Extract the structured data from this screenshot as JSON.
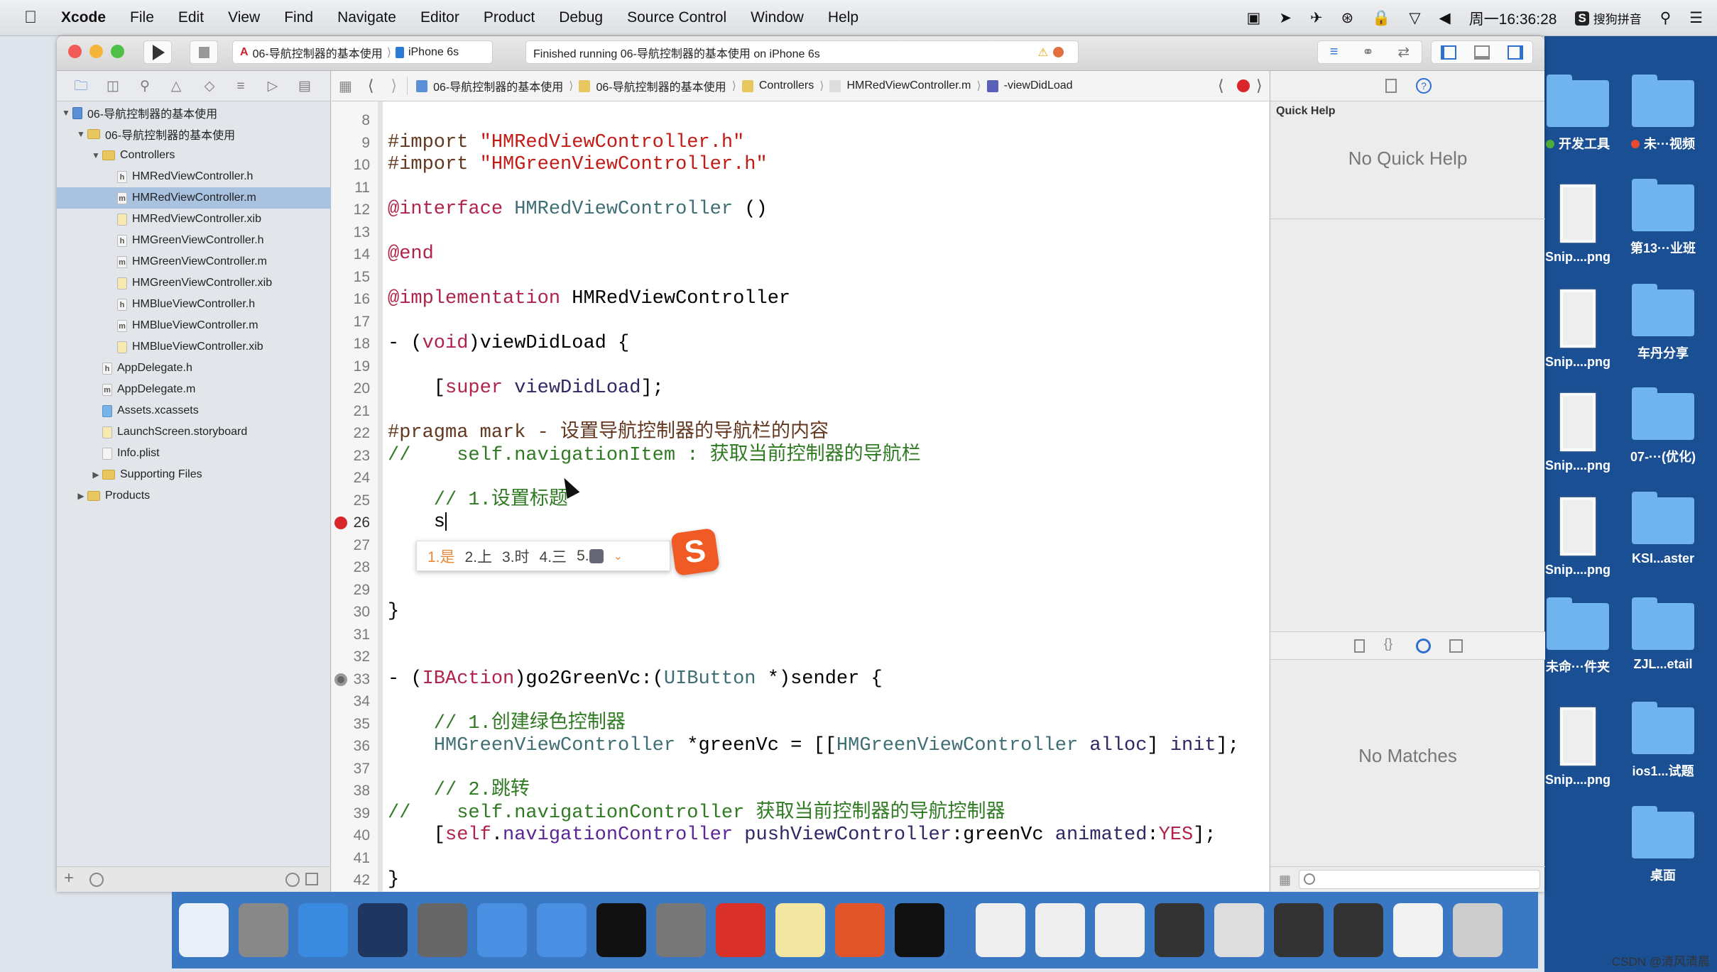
{
  "menubar": {
    "app": "Xcode",
    "items": [
      "File",
      "Edit",
      "View",
      "Find",
      "Navigate",
      "Editor",
      "Product",
      "Debug",
      "Source Control",
      "Window",
      "Help"
    ],
    "clock": "周一16:36:28",
    "ime": "搜狗拼音"
  },
  "toolbar": {
    "scheme": "06-导航控制器的基本使用",
    "device": "iPhone 6s",
    "status": "Finished running 06-导航控制器的基本使用 on iPhone 6s"
  },
  "jumpbar": [
    "06-导航控制器的基本使用",
    "06-导航控制器的基本使用",
    "Controllers",
    "HMRedViewController.m",
    "-viewDidLoad"
  ],
  "navigator": {
    "items": [
      {
        "label": "06-导航控制器的基本使用",
        "level": 0,
        "kind": "proj",
        "open": true
      },
      {
        "label": "06-导航控制器的基本使用",
        "level": 1,
        "kind": "folder",
        "open": true
      },
      {
        "label": "Controllers",
        "level": 2,
        "kind": "folder",
        "open": true
      },
      {
        "label": "HMRedViewController.h",
        "level": 3,
        "kind": "h"
      },
      {
        "label": "HMRedViewController.m",
        "level": 3,
        "kind": "m",
        "selected": true
      },
      {
        "label": "HMRedViewController.xib",
        "level": 3,
        "kind": "xib"
      },
      {
        "label": "HMGreenViewController.h",
        "level": 3,
        "kind": "h"
      },
      {
        "label": "HMGreenViewController.m",
        "level": 3,
        "kind": "m"
      },
      {
        "label": "HMGreenViewController.xib",
        "level": 3,
        "kind": "xib"
      },
      {
        "label": "HMBlueViewController.h",
        "level": 3,
        "kind": "h"
      },
      {
        "label": "HMBlueViewController.m",
        "level": 3,
        "kind": "m"
      },
      {
        "label": "HMBlueViewController.xib",
        "level": 3,
        "kind": "xib"
      },
      {
        "label": "AppDelegate.h",
        "level": 2,
        "kind": "h"
      },
      {
        "label": "AppDelegate.m",
        "level": 2,
        "kind": "m"
      },
      {
        "label": "Assets.xcassets",
        "level": 2,
        "kind": "assets"
      },
      {
        "label": "LaunchScreen.storyboard",
        "level": 2,
        "kind": "xib"
      },
      {
        "label": "Info.plist",
        "level": 2,
        "kind": "plist"
      },
      {
        "label": "Supporting Files",
        "level": 2,
        "kind": "folder",
        "open": false
      },
      {
        "label": "Products",
        "level": 1,
        "kind": "folder",
        "open": false
      }
    ]
  },
  "code": [
    {
      "n": "8",
      "t": []
    },
    {
      "n": "9",
      "t": [
        [
          "pre",
          "#import "
        ],
        [
          "str",
          "\"HMRedViewController.h\""
        ]
      ]
    },
    {
      "n": "10",
      "t": [
        [
          "pre",
          "#import "
        ],
        [
          "str",
          "\"HMGreenViewController.h\""
        ]
      ]
    },
    {
      "n": "11",
      "t": []
    },
    {
      "n": "12",
      "t": [
        [
          "kw",
          "@interface "
        ],
        [
          "cls",
          "HMRedViewController"
        ],
        [
          "pl",
          " ()"
        ]
      ]
    },
    {
      "n": "13",
      "t": []
    },
    {
      "n": "14",
      "t": [
        [
          "kw",
          "@end"
        ]
      ]
    },
    {
      "n": "15",
      "t": []
    },
    {
      "n": "16",
      "t": [
        [
          "kw",
          "@implementation "
        ],
        [
          "pl",
          "HMRedViewController"
        ]
      ]
    },
    {
      "n": "17",
      "t": []
    },
    {
      "n": "18",
      "t": [
        [
          "pl",
          "- ("
        ],
        [
          "kw",
          "void"
        ],
        [
          "pl",
          ")viewDidLoad {"
        ]
      ]
    },
    {
      "n": "19",
      "t": []
    },
    {
      "n": "20",
      "t": [
        [
          "pl",
          "    ["
        ],
        [
          "kw",
          "super"
        ],
        [
          "pl",
          " "
        ],
        [
          "meth",
          "viewDidLoad"
        ],
        [
          "pl",
          "];"
        ]
      ]
    },
    {
      "n": "21",
      "t": []
    },
    {
      "n": "22",
      "t": [
        [
          "pre",
          "#pragma mark - 设置导航控制器的导航栏的内容"
        ]
      ]
    },
    {
      "n": "23",
      "t": [
        [
          "com",
          "//    self.navigationItem : 获取当前控制器的导航栏"
        ]
      ]
    },
    {
      "n": "24",
      "t": []
    },
    {
      "n": "25",
      "t": [
        [
          "com",
          "    // 1.设置标题"
        ]
      ]
    },
    {
      "n": "26",
      "t": [
        [
          "pl",
          "    s"
        ]
      ],
      "error": true
    },
    {
      "n": "27",
      "t": []
    },
    {
      "n": "28",
      "t": []
    },
    {
      "n": "29",
      "t": []
    },
    {
      "n": "30",
      "t": [
        [
          "pl",
          "}"
        ]
      ]
    },
    {
      "n": "31",
      "t": []
    },
    {
      "n": "32",
      "t": []
    },
    {
      "n": "33",
      "t": [
        [
          "pl",
          "- ("
        ],
        [
          "kw",
          "IBAction"
        ],
        [
          "pl",
          ")go2GreenVc:("
        ],
        [
          "cls",
          "UIButton"
        ],
        [
          "pl",
          " *)sender {"
        ]
      ],
      "connection": true
    },
    {
      "n": "34",
      "t": []
    },
    {
      "n": "35",
      "t": [
        [
          "com",
          "    // 1.创建绿色控制器"
        ]
      ]
    },
    {
      "n": "36",
      "t": [
        [
          "pl",
          "    "
        ],
        [
          "cls",
          "HMGreenViewController"
        ],
        [
          "pl",
          " *greenVc = [["
        ],
        [
          "cls",
          "HMGreenViewController"
        ],
        [
          "pl",
          " "
        ],
        [
          "meth",
          "alloc"
        ],
        [
          "pl",
          "] "
        ],
        [
          "meth",
          "init"
        ],
        [
          "pl",
          "];"
        ]
      ]
    },
    {
      "n": "37",
      "t": []
    },
    {
      "n": "38",
      "t": [
        [
          "com",
          "    // 2.跳转"
        ]
      ]
    },
    {
      "n": "39",
      "t": [
        [
          "com",
          "//    self.navigationController 获取当前控制器的导航控制器"
        ]
      ]
    },
    {
      "n": "40",
      "t": [
        [
          "pl",
          "    ["
        ],
        [
          "kw",
          "self"
        ],
        [
          "pl",
          "."
        ],
        [
          "prop",
          "navigationController"
        ],
        [
          "pl",
          " "
        ],
        [
          "meth",
          "pushViewController"
        ],
        [
          "pl",
          ":greenVc "
        ],
        [
          "meth",
          "animated"
        ],
        [
          "pl",
          ":"
        ],
        [
          "kw",
          "YES"
        ],
        [
          "pl",
          "];"
        ]
      ]
    },
    {
      "n": "41",
      "t": []
    },
    {
      "n": "42",
      "t": [
        [
          "pl",
          "}"
        ]
      ]
    }
  ],
  "ime": {
    "candidates": [
      "1.是",
      "2.上",
      "3.时",
      "4.三",
      "5."
    ]
  },
  "inspector": {
    "quick_help_title": "Quick Help",
    "no_quick_help": "No Quick Help",
    "no_matches": "No Matches"
  },
  "desktop": {
    "left": [
      {
        "label": "开发工具",
        "kind": "folder",
        "dot": "#4caf3a"
      },
      {
        "label": "Snip....png",
        "kind": "png"
      },
      {
        "label": "Snip....png",
        "kind": "png"
      },
      {
        "label": "Snip....png",
        "kind": "png"
      },
      {
        "label": "Snip....png",
        "kind": "png"
      },
      {
        "label": "未命···件夹",
        "kind": "folder"
      },
      {
        "label": "Snip....png",
        "kind": "png"
      }
    ],
    "right": [
      {
        "label": "未···视频",
        "kind": "folder",
        "dot": "#e84a2f"
      },
      {
        "label": "第13···业班",
        "kind": "folder"
      },
      {
        "label": "车丹分享",
        "kind": "folder"
      },
      {
        "label": "07-···(优化)",
        "kind": "folder"
      },
      {
        "label": "KSI...aster",
        "kind": "folder"
      },
      {
        "label": "ZJL...etail",
        "kind": "folder"
      },
      {
        "label": "ios1...试题",
        "kind": "folder"
      },
      {
        "label": "桌面",
        "kind": "folder"
      }
    ]
  },
  "dock": [
    "finder-icon",
    "launchpad-icon",
    "safari-icon",
    "mouse-app-icon",
    "movie-icon",
    "xcode-icon",
    "instruments-icon",
    "terminal-icon",
    "system-preferences-icon",
    "xmind-icon",
    "notes-icon",
    "powerpoint-icon",
    "console-icon",
    "window-thumb-icon",
    "window-thumb-icon",
    "window-thumb-icon",
    "window-thumb-icon",
    "window-thumb-icon",
    "window-thumb-icon",
    "window-thumb-icon",
    "document-icon",
    "trash-icon"
  ],
  "colors": {
    "selection": "#a9c2e0",
    "error": "#d9262a",
    "dock": "#3b78c4",
    "desktop": "#1b4f93"
  },
  "watermark": "CSDN @清风清晨"
}
